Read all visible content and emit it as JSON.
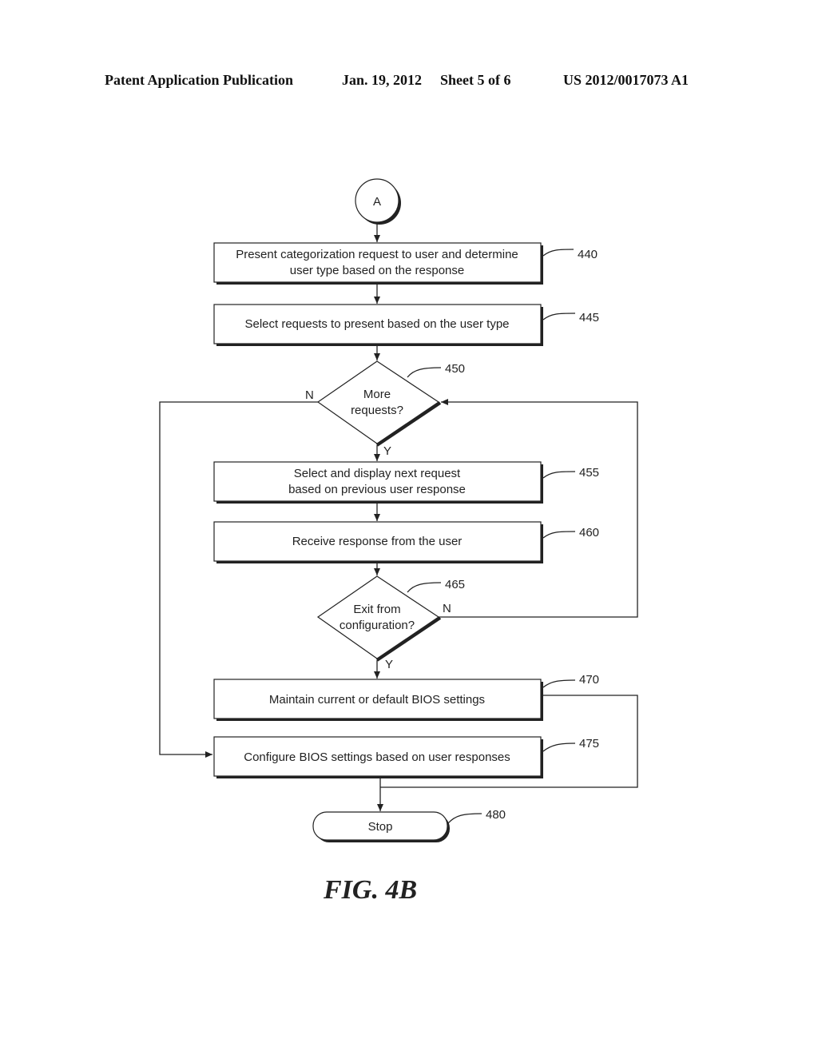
{
  "header": {
    "publication": "Patent Application Publication",
    "date": "Jan. 19, 2012",
    "sheet": "Sheet 5 of 6",
    "number": "US 2012/0017073 A1"
  },
  "flowchart": {
    "connector": "A",
    "steps": {
      "s440": {
        "line1": "Present categorization request to user and determine",
        "line2": "user type based on the response",
        "ref": "440"
      },
      "s445": {
        "text": "Select requests to present based on the user type",
        "ref": "445"
      },
      "d450": {
        "line1": "More",
        "line2": "requests?",
        "ref": "450",
        "no": "N",
        "yes": "Y"
      },
      "s455": {
        "line1": "Select and display next request",
        "line2": "based on previous user response",
        "ref": "455"
      },
      "s460": {
        "text": "Receive response from the user",
        "ref": "460"
      },
      "d465": {
        "line1": "Exit from",
        "line2": "configuration?",
        "ref": "465",
        "no": "N",
        "yes": "Y"
      },
      "s470": {
        "text": "Maintain current or default BIOS settings",
        "ref": "470"
      },
      "s475": {
        "text": "Configure BIOS settings based on user responses",
        "ref": "475"
      },
      "s480": {
        "text": "Stop",
        "ref": "480"
      }
    }
  },
  "figure_label": "FIG. 4B"
}
